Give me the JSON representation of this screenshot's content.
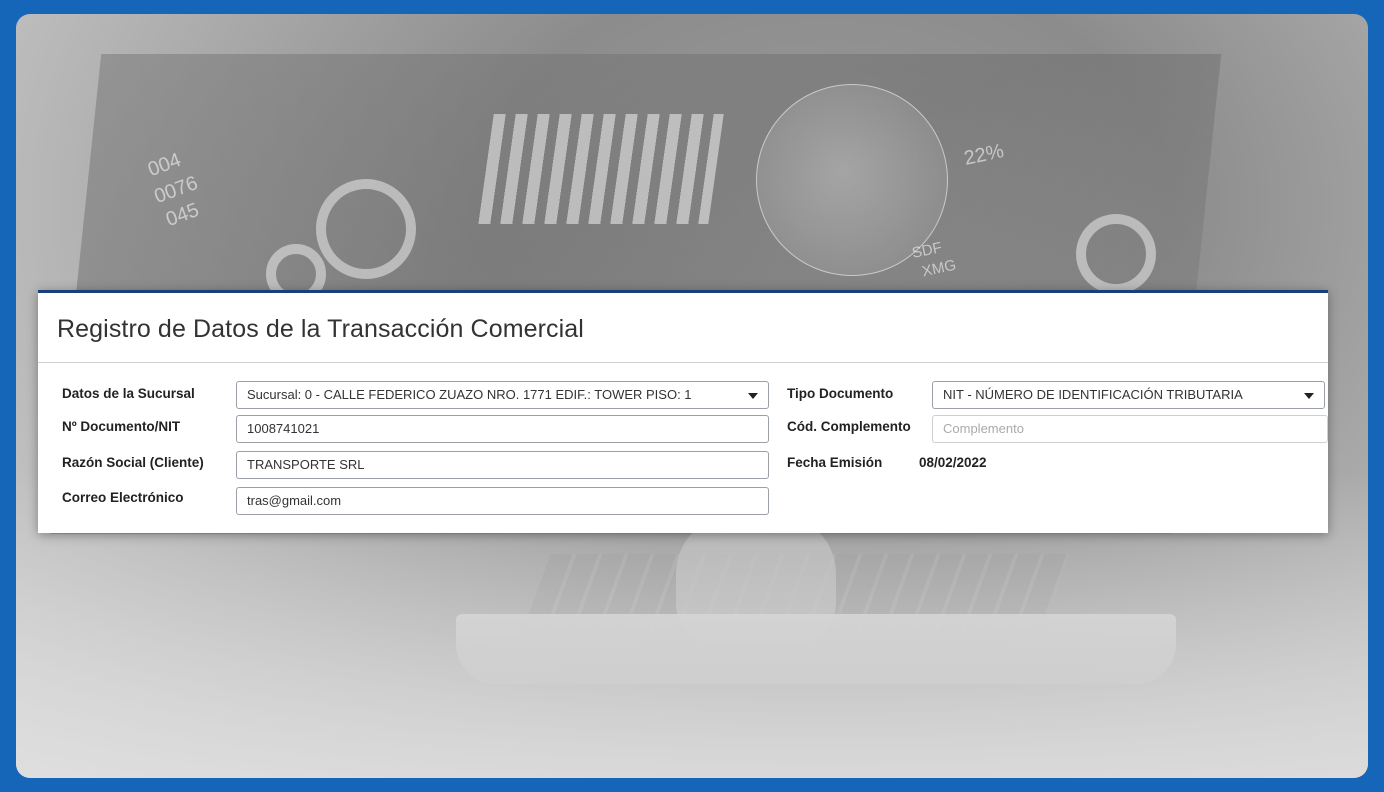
{
  "form": {
    "title": "Registro de Datos de la Transacción Comercial",
    "labels": {
      "sucursal": "Datos de la Sucursal",
      "documento": "Nº Documento/NIT",
      "razon_social": "Razón Social (Cliente)",
      "correo": "Correo Electrónico",
      "tipo_documento": "Tipo Documento",
      "complemento": "Cód. Complemento",
      "fecha": "Fecha Emisión"
    },
    "values": {
      "sucursal": "Sucursal: 0 - CALLE FEDERICO ZUAZO NRO. 1771 EDIF.: TOWER PISO: 1",
      "documento": "1008741021",
      "razon_social": "TRANSPORTE SRL",
      "correo": "tras@gmail.com",
      "tipo_documento": "NIT - NÚMERO DE IDENTIFICACIÓN TRIBUTARIA",
      "fecha": "08/02/2022"
    },
    "placeholders": {
      "complemento": "Complemento"
    }
  },
  "background": {
    "texts": [
      "004",
      "0076",
      "045",
      "22%",
      "SDF",
      "XMG"
    ]
  },
  "colors": {
    "frame": "#1565b8",
    "panel_accent": "#1b3f7a"
  }
}
